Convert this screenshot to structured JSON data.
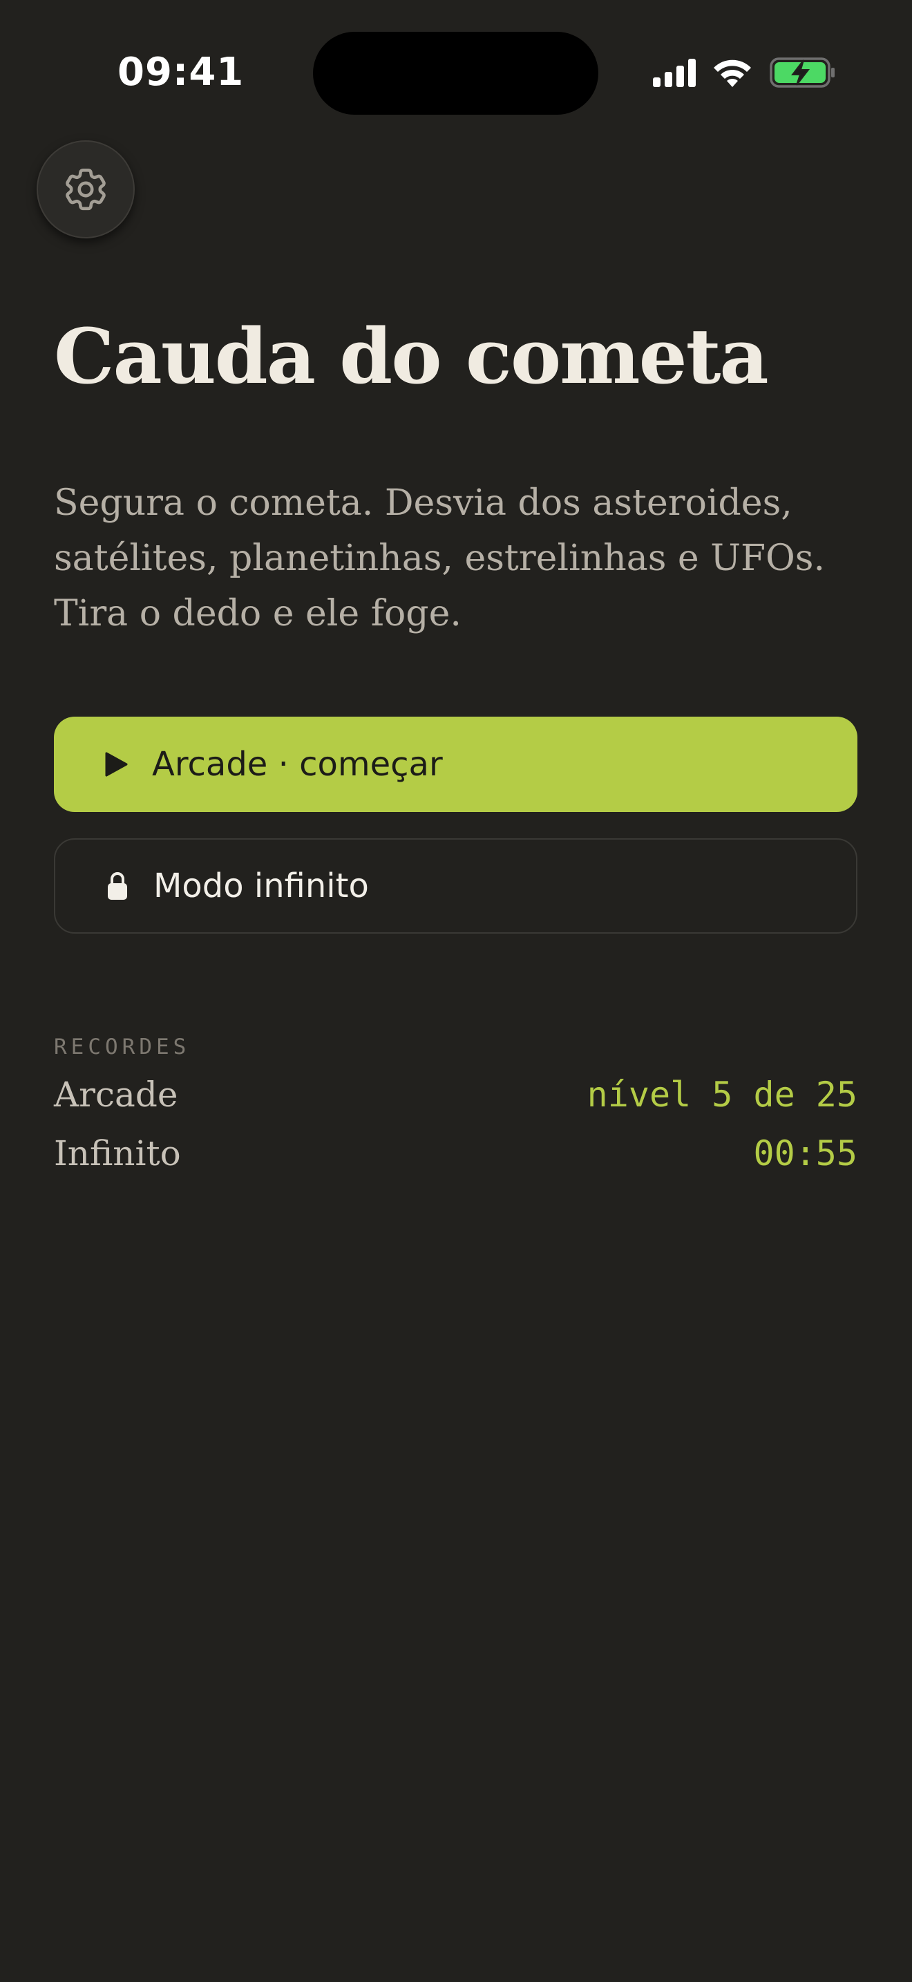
{
  "status_bar": {
    "time": "09:41",
    "icons": [
      "cellular-signal-icon",
      "wifi-icon",
      "battery-charging-icon"
    ]
  },
  "settings": {
    "icon": "gear-icon"
  },
  "title": "Cauda do cometa",
  "description": "Segura o cometa. Desvia dos asteroides, satélites, planetinhas, estrelinhas e UFOs. Tira o dedo e ele foge.",
  "buttons": {
    "arcade": {
      "label": "Arcade · começar",
      "icon": "play-icon"
    },
    "infinite": {
      "label": "Modo infinito",
      "icon": "lock-icon"
    }
  },
  "records": {
    "heading": "RECORDES",
    "items": [
      {
        "label": "Arcade",
        "value": "nível 5 de 25"
      },
      {
        "label": "Infinito",
        "value": "00:55"
      }
    ]
  },
  "colors": {
    "background": "#22211e",
    "accent": "#b4cc46",
    "title": "#f0ebe1",
    "text_muted": "#b6b0a6",
    "battery_green": "#4cd964"
  }
}
